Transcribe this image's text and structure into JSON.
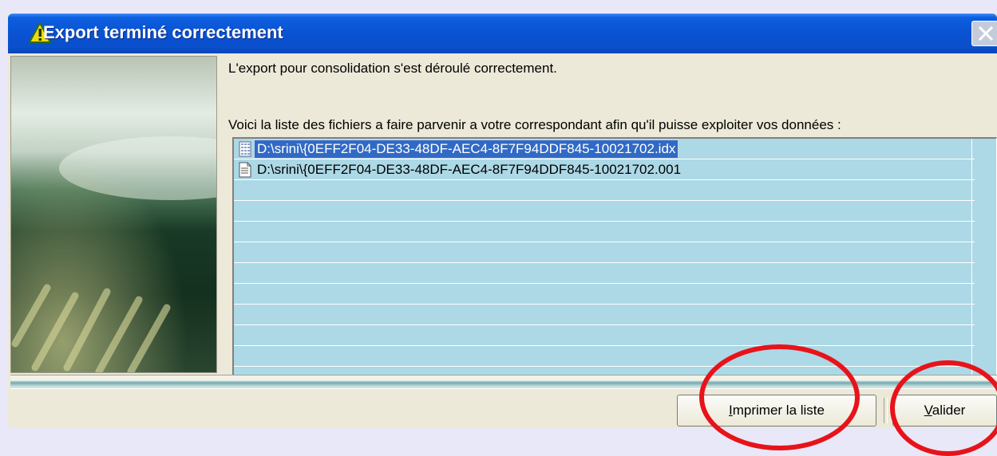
{
  "window": {
    "title": "Export terminé correctement",
    "titlebar_color": "#0a52d2"
  },
  "content": {
    "message": "L'export pour consolidation s'est déroulé correctement.",
    "instruction": "Voici la liste des fichiers a faire parvenir a votre correspondant afin qu'il puisse exploiter vos données :",
    "files": [
      {
        "name": "D:\\srini\\{0EFF2F04-DE33-48DF-AEC4-8F7F94DDF845-10021702.idx",
        "icon": "index-file-icon",
        "selected": true
      },
      {
        "name": "D:\\srini\\{0EFF2F04-DE33-48DF-AEC4-8F7F94DDF845-10021702.001",
        "icon": "text-file-icon",
        "selected": false
      }
    ],
    "list_bg_color": "#add8e6",
    "selection_color": "#316ac5"
  },
  "buttons": {
    "print_prefix": "I",
    "print_rest": "mprimer la liste",
    "ok_prefix": "V",
    "ok_rest": "alider"
  },
  "annotations": {
    "color": "#e8131a",
    "circled": [
      "Imprimer la liste",
      "Valider"
    ]
  }
}
